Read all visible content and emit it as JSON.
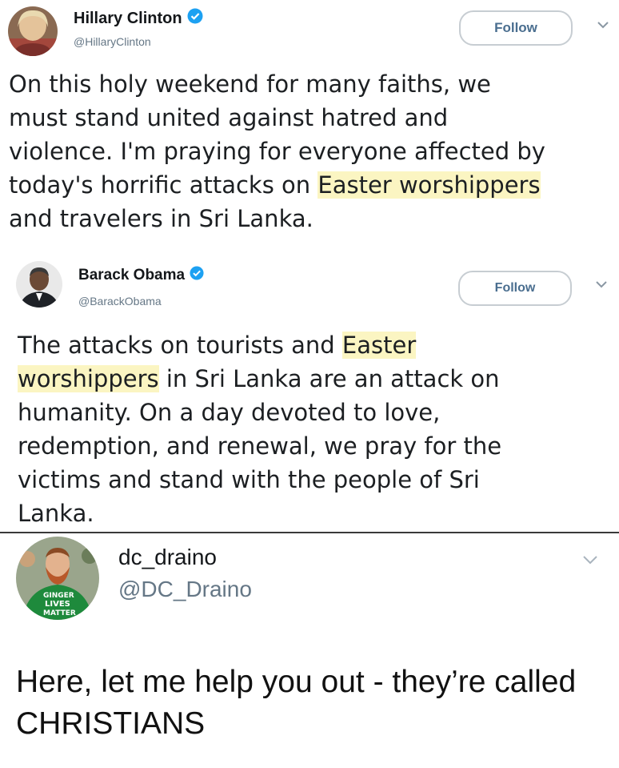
{
  "tweets": [
    {
      "name": "Hillary Clinton",
      "handle": "@HillaryClinton",
      "follow_label": "Follow",
      "verified": true,
      "text_before": "On this holy weekend for many faiths, we\nmust stand united against hatred and\nviolence. I'm praying for everyone affected by\ntoday's horrific attacks on ",
      "highlight": "Easter worshippers",
      "text_after": "\nand travelers in Sri Lanka."
    },
    {
      "name": "Barack Obama",
      "handle": "@BarackObama",
      "follow_label": "Follow",
      "verified": true,
      "text_before": "The attacks on tourists and ",
      "highlight_1": "Easter",
      "text_mid": "\n",
      "highlight_2": "worshippers",
      "text_after": " in Sri Lanka are an attack on\nhumanity. On a day devoted to love,\nredemption, and renewal, we pray for the\nvictims and stand with the people of Sri\nLanka."
    },
    {
      "name": "dc_draino",
      "handle": "@DC_Draino",
      "avatar_shirt_text": "GINGER LIVES MATTER",
      "text": "Here, let me help you out - they’re called\nCHRISTIANS"
    }
  ],
  "colors": {
    "highlight": "#fbf5c2",
    "verified_blue": "#1da1f2",
    "follow_text": "#4a6e8f",
    "handle_gray": "#657786"
  },
  "icons": [
    "verified-badge-icon",
    "chevron-down-icon"
  ]
}
